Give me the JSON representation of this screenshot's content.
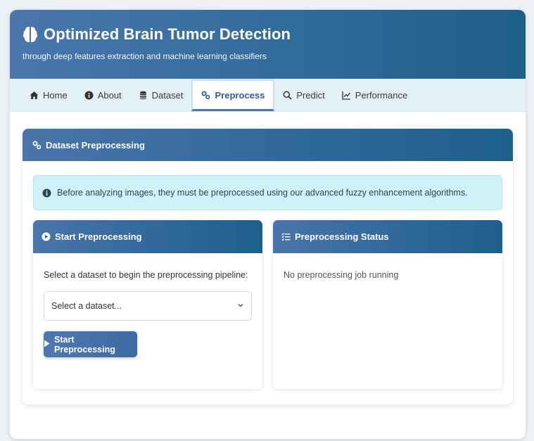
{
  "header": {
    "title": "Optimized Brain Tumor Detection",
    "subtitle": "through deep features extraction and machine learning classifiers"
  },
  "nav": {
    "items": [
      {
        "label": "Home",
        "icon": "home-icon"
      },
      {
        "label": "About",
        "icon": "info-icon"
      },
      {
        "label": "Dataset",
        "icon": "database-icon"
      },
      {
        "label": "Preprocess",
        "icon": "gears-icon",
        "active": true
      },
      {
        "label": "Predict",
        "icon": "search-icon"
      },
      {
        "label": "Performance",
        "icon": "chart-line-icon"
      }
    ]
  },
  "main": {
    "card_title": "Dataset Preprocessing",
    "alert_text": "Before analyzing images, they must be preprocessed using our advanced fuzzy enhancement algorithms.",
    "start_panel": {
      "title": "Start Preprocessing",
      "instruction": "Select a dataset to begin the preprocessing pipeline:",
      "select_value": "Select a dataset...",
      "button_label": "Start Preprocessing"
    },
    "status_panel": {
      "title": "Preprocessing Status",
      "status_text": "No preprocessing job running"
    }
  },
  "colors": {
    "header_start": "#4a76ad",
    "header_end": "#1e5f88",
    "nav_bg": "#e3f1f7",
    "active_tab": "#2d5d8f",
    "alert_bg": "#cff1f8"
  }
}
